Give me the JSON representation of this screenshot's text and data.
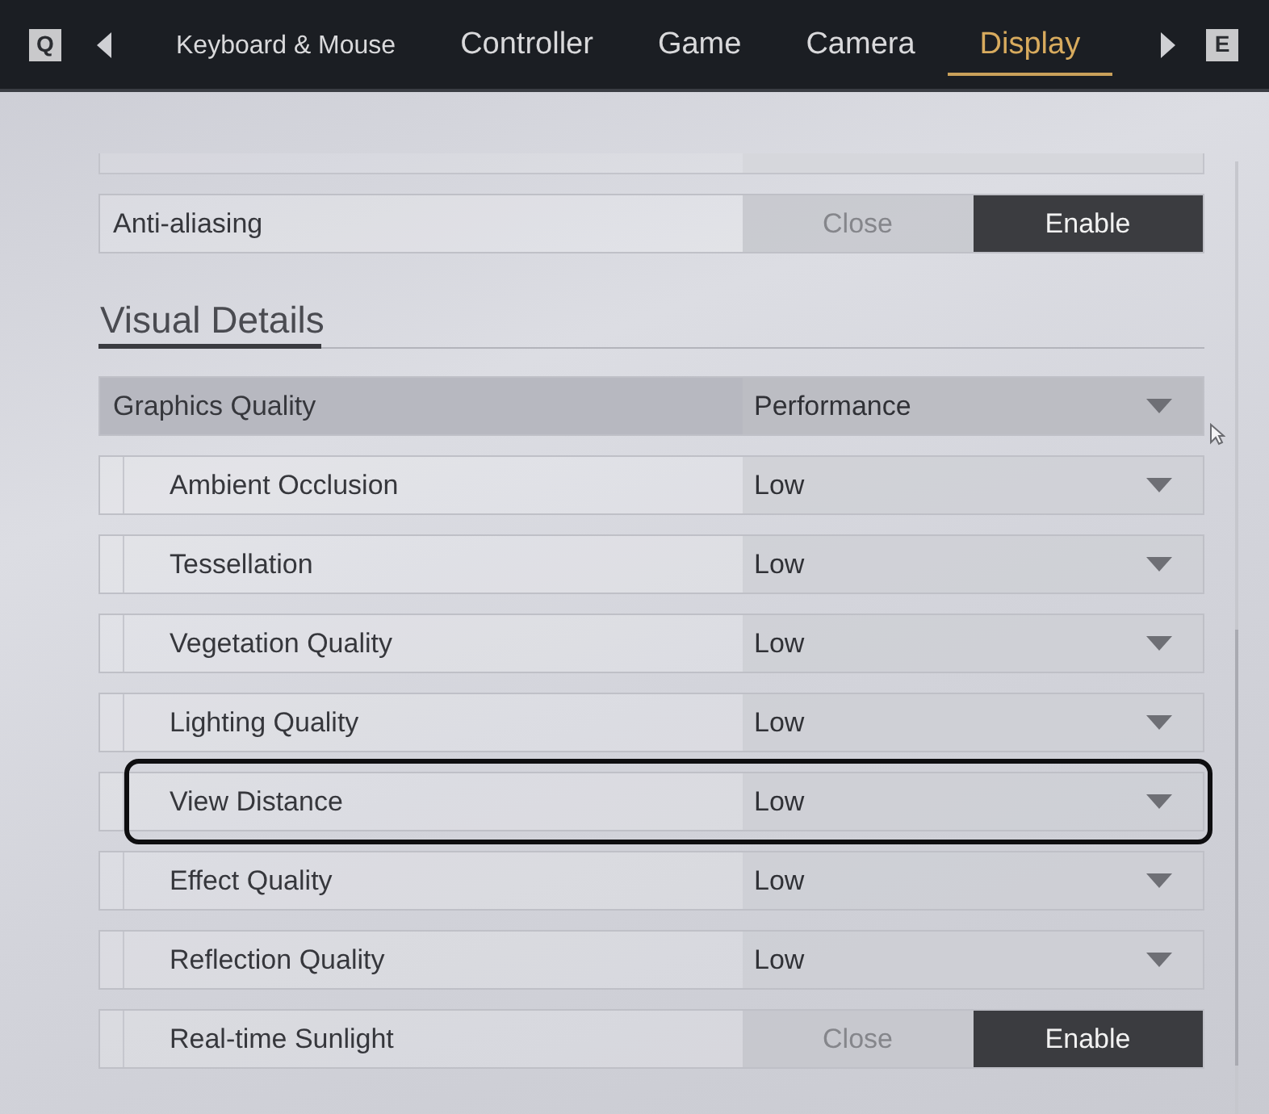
{
  "tabs_bar": {
    "prev_key": "Q",
    "next_key": "E",
    "tabs": [
      {
        "label": "Keyboard & Mouse",
        "selected": false
      },
      {
        "label": "Controller",
        "selected": false
      },
      {
        "label": "Game",
        "selected": false
      },
      {
        "label": "Camera",
        "selected": false
      },
      {
        "label": "Display",
        "selected": true
      }
    ]
  },
  "top_rows": [
    {
      "kind": "toggle",
      "label": "Anti-aliasing",
      "highlighted": false,
      "focused": false,
      "options": [
        {
          "label": "Close",
          "selected": false
        },
        {
          "label": "Enable",
          "selected": true
        }
      ]
    }
  ],
  "section": {
    "title": "Visual Details",
    "rows": [
      {
        "kind": "dropdown",
        "label": "Graphics Quality",
        "value": "Performance",
        "highlighted": true,
        "focused": false,
        "children": [
          {
            "kind": "dropdown",
            "label": "Ambient Occlusion",
            "value": "Low",
            "highlighted": false,
            "focused": false
          },
          {
            "kind": "dropdown",
            "label": "Tessellation",
            "value": "Low",
            "highlighted": false,
            "focused": false
          },
          {
            "kind": "dropdown",
            "label": "Vegetation Quality",
            "value": "Low",
            "highlighted": false,
            "focused": false
          },
          {
            "kind": "dropdown",
            "label": "Lighting Quality",
            "value": "Low",
            "highlighted": false,
            "focused": false
          },
          {
            "kind": "dropdown",
            "label": "View Distance",
            "value": "Low",
            "highlighted": false,
            "focused": true
          },
          {
            "kind": "dropdown",
            "label": "Effect Quality",
            "value": "Low",
            "highlighted": false,
            "focused": false
          },
          {
            "kind": "dropdown",
            "label": "Reflection Quality",
            "value": "Low",
            "highlighted": false,
            "focused": false
          },
          {
            "kind": "toggle",
            "label": "Real-time Sunlight",
            "highlighted": false,
            "focused": false,
            "options": [
              {
                "label": "Close",
                "selected": false
              },
              {
                "label": "Enable",
                "selected": true
              }
            ]
          }
        ]
      }
    ]
  }
}
